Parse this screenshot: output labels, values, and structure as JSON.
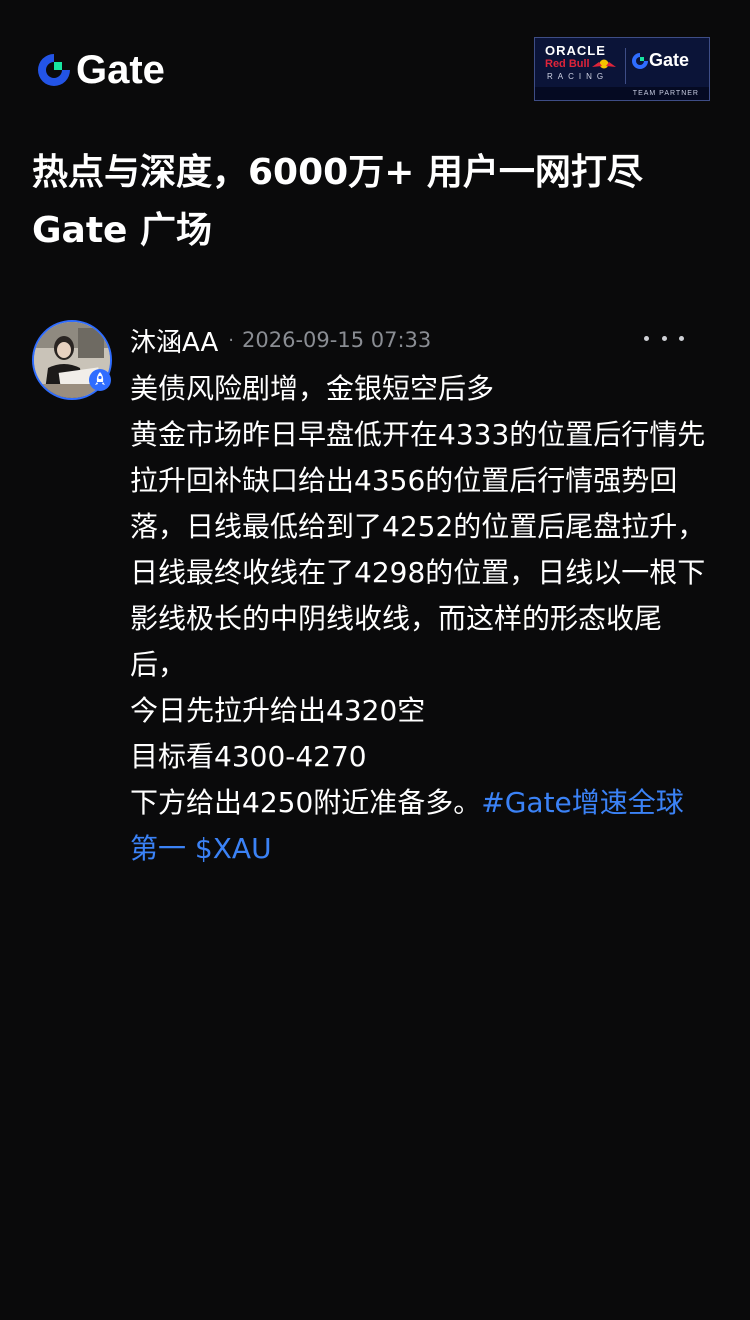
{
  "header": {
    "brand": "Gate",
    "partner_badge": {
      "oracle": "ORACLE",
      "redbull": "Red Bull",
      "racing": "RACING",
      "gate": "Gate",
      "team_partner": "TEAM PARTNER"
    }
  },
  "headline": {
    "line1": "热点与深度，6000万+ 用户一网打尽",
    "line2": "Gate 广场"
  },
  "post": {
    "author": "沐涵AA",
    "separator": "·",
    "timestamp": "2026-09-15 07:33",
    "body": {
      "title": "美债风险剧增，金银短空后多",
      "paragraph": "黄金市场昨日早盘低开在4333的位置后行情先拉升回补缺口给出4356的位置后行情强势回落，日线最低给到了4252的位置后尾盘拉升，日线最终收线在了4298的位置，日线以一根下影线极长的中阴线收线，而这样的形态收尾后，",
      "line_today": "今日先拉升给出4320空",
      "line_target": "目标看4300-4270",
      "line_below": "下方给出4250附近准备多。",
      "hashtag": "#Gate增速全球第一",
      "ticker": "$XAU"
    }
  },
  "colors": {
    "background": "#0a0a0b",
    "accent_blue": "#3b82f6",
    "brand_green": "#17e6a1",
    "muted_text": "#8a8d93"
  },
  "icons": {
    "logo": "gate-logo-icon",
    "more": "more-horizontal-icon",
    "verified": "rocket-badge-icon"
  }
}
